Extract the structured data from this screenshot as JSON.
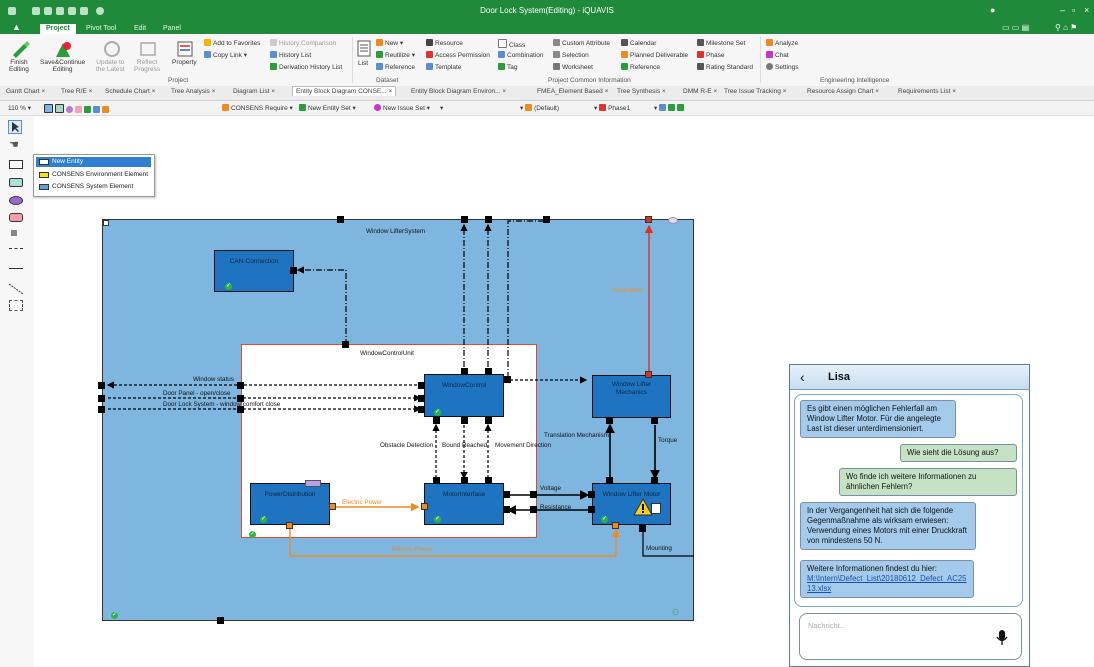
{
  "window": {
    "title": "Door Lock System(Editing) - iQUAVIS",
    "main_tabs": [
      "Project",
      "Pivot Tool",
      "Edit",
      "Panel"
    ]
  },
  "ribbon": {
    "finish_editing": "Finish\nEditing",
    "save_continue": "Save&Continue\nEditing",
    "update_latest": "Update to\nthe Latest",
    "reflect_progress": "Reflect\nProgress",
    "property": "Property",
    "add_favorites": "Add to Favorites",
    "copy_link": "Copy Link",
    "history_comparison": "History Comparison",
    "history_list": "History List",
    "derivation_history": "Derivation History List",
    "list": "List",
    "new": "New",
    "reutilize": "Reutilize",
    "reference": "Reference",
    "resource": "Resource",
    "access_permission": "Access Permission",
    "template": "Template",
    "class": "Class",
    "combination": "Combination",
    "tag": "Tag",
    "custom_attribute": "Custom Attribute",
    "selection": "Selection",
    "worksheet": "Worksheet",
    "calendar": "Calendar",
    "planned_deliverable": "Planned Deliverable",
    "reference2": "Reference",
    "milestone_set": "Milestone Set",
    "phase": "Phase",
    "rating_standard": "Rating Standard",
    "analyze": "Analyze",
    "chat": "Chat",
    "settings": "Settings",
    "group_project": "Project",
    "group_dataset": "Dataset",
    "group_common": "Project Common Information",
    "group_ei": "Engineering Intelligence"
  },
  "doc_tabs": [
    "Gantt Chart",
    "Tree R/E",
    "Schedule Chart",
    "Tree Analysis",
    "Diagram List",
    "Entity Block Diagram CONSE...",
    "Entity Block Diagram Environ...",
    "FMEA_Element Based",
    "Tree Synthesis",
    "DMM R-E",
    "Tree Issue Tracking",
    "Resource Assign Chart",
    "Requirements List"
  ],
  "toolbar": {
    "zoom": "110 %",
    "consens_require": "CONSENS Require",
    "new_entity_set": "New Entity Set",
    "new_issue_set": "New Issue Set",
    "default": "(Default)",
    "phase": "Phase1"
  },
  "popup": {
    "items": [
      "New Entity",
      "CONSENS Environment Element",
      "CONSENS System Element"
    ],
    "colors": [
      "#ffffff",
      "#f5e21c",
      "#5b9fd6"
    ]
  },
  "diagram": {
    "system_title": "Window LifterSystem",
    "unit_title": "WindowControlUnit",
    "can": "CAN-Connection",
    "window_control": "WindowControl",
    "wl_mechanics": "Window Lifter\nMechanics",
    "power_distribution": "PowerDistribution",
    "motor_interface": "MotorInterface",
    "wl_motor": "Window Lifter Motor",
    "window_status": "Window status",
    "door_panel": "Door Panel - open/close",
    "comfort_close": "Door Lock System - window comfort close",
    "obstacle": "Obstacle Detection",
    "bound_reached": "Bound Reached",
    "movement_direction": "Movement Direction",
    "translation": "Translation Mechanism",
    "torque": "Torque",
    "voltage": "Voltage",
    "resistance": "Resistance",
    "electric_power": "Electric Power",
    "electric_power2": "Electric Power",
    "incarnation": "incarnation",
    "mounting": "Mounting"
  },
  "chat": {
    "name": "Lisa",
    "messages": [
      {
        "from": "in",
        "text": "Es gibt einen möglichen Fehlerfall am Window Lifter Motor. Für die angelegte Last ist dieser unterdimensioniert."
      },
      {
        "from": "out",
        "text": "Wie sieht die Lösung aus?"
      },
      {
        "from": "out",
        "text": "Wo finde ich weitere Informationen zu ähnlichen Fehlern?"
      },
      {
        "from": "in",
        "text": "In der Vergangenheit hat sich die folgende Gegenmaßnahme als wirksam erwiesen: Verwendung eines Motors mit einer Druckkraft von mindestens 50 N."
      },
      {
        "from": "in",
        "text": "Weitere Informationen findest du hier:",
        "link": "M:\\Intern\\Defect_List\\20180612_Defect_AC2513.xlsx"
      }
    ],
    "input_placeholder": "Nachricht..."
  }
}
